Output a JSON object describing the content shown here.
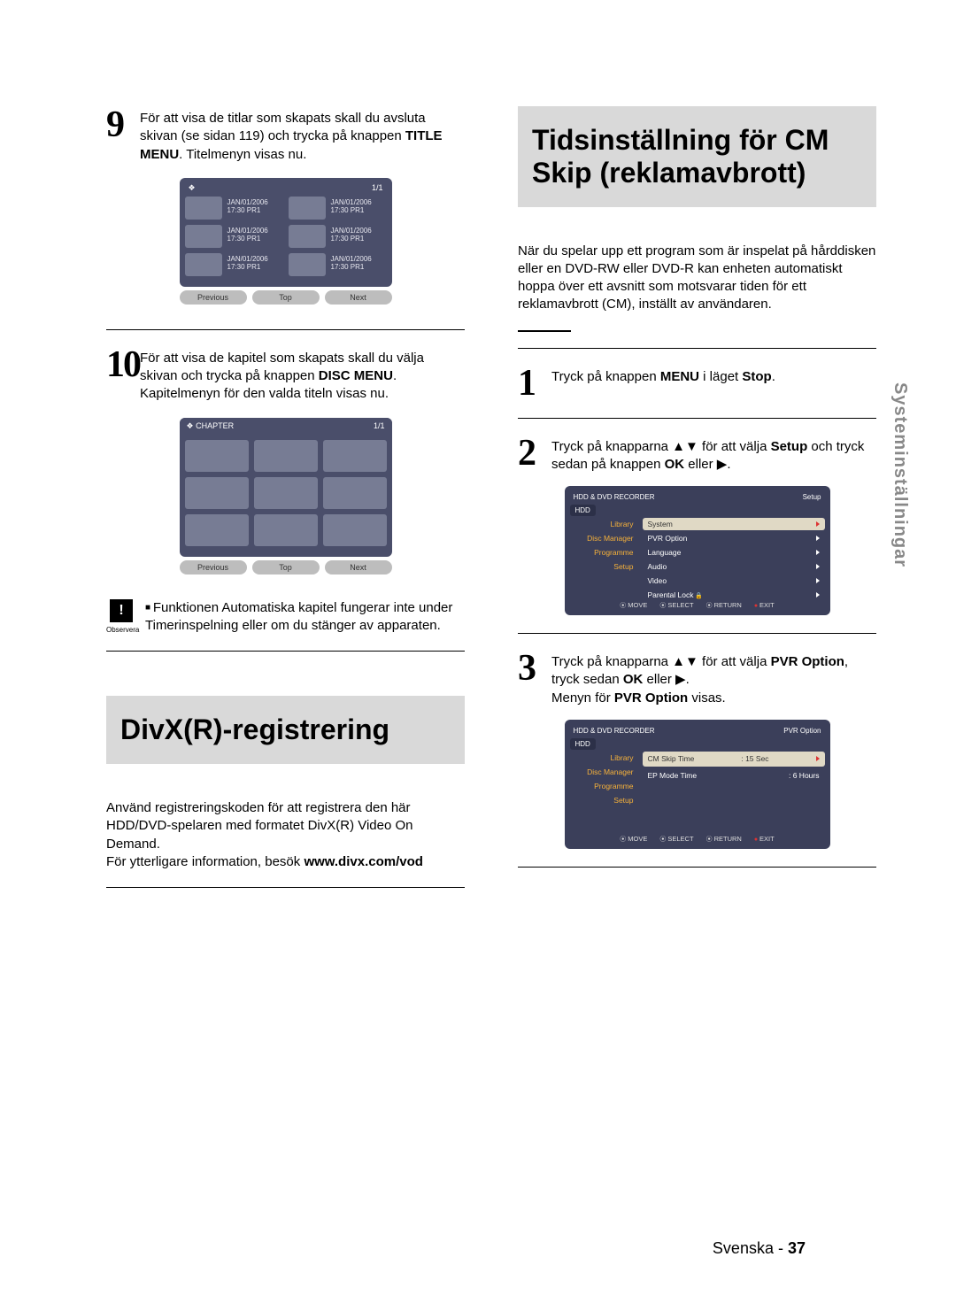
{
  "footer": {
    "lang": "Svenska",
    "sep": " - ",
    "page": "37"
  },
  "side_tab": "Systeminställningar",
  "left": {
    "step9": {
      "num": "9",
      "text_a": "För att visa de titlar som skapats skall du avsluta skivan (se sidan 119) och trycka på knappen ",
      "b1": "TITLE MENU",
      "text_b": ". Titelmenyn visas nu."
    },
    "title_menu": {
      "icon": "❖",
      "count": "1/1",
      "cells": [
        {
          "date": "JAN/01/2006",
          "time": "17:30 PR1"
        },
        {
          "date": "JAN/01/2006",
          "time": "17:30 PR1"
        },
        {
          "date": "JAN/01/2006",
          "time": "17:30 PR1"
        },
        {
          "date": "JAN/01/2006",
          "time": "17:30 PR1"
        },
        {
          "date": "JAN/01/2006",
          "time": "17:30 PR1"
        },
        {
          "date": "JAN/01/2006",
          "time": "17:30 PR1"
        }
      ],
      "btns": [
        "Previous",
        "Top",
        "Next"
      ]
    },
    "step10": {
      "num": "10",
      "text_a": "För att visa de kapitel som skapats skall du välja skivan och trycka på knappen ",
      "b1": "DISC MENU",
      "text_b": ". Kapitelmenyn för den valda titeln visas nu."
    },
    "chapter_menu": {
      "head_icon": "❖",
      "head_label": "CHAPTER",
      "count": "1/1",
      "btns": [
        "Previous",
        "Top",
        "Next"
      ]
    },
    "observe": {
      "label": "Observera",
      "text": "Funktionen Automatiska kapitel fungerar inte under Timerinspelning eller om du stänger av apparaten."
    },
    "divx_title": "DivX(R)-registrering",
    "divx_text_a": "Använd registreringskoden för att registrera den här HDD/DVD-spelaren med formatet DivX(R) Video On Demand.",
    "divx_text_b_prefix": "För ytterligare information, besök ",
    "divx_text_b_bold": "www.divx.com/vod"
  },
  "right": {
    "title": "Tidsinställning för CM Skip (reklamavbrott)",
    "intro": "När du spelar upp ett program som är inspelat på hårddisken eller en DVD-RW eller DVD-R kan enheten automatiskt hoppa över ett avsnitt som motsvarar tiden för ett reklamavbrott (CM), inställt av användaren.",
    "step1": {
      "num": "1",
      "a": "Tryck på knappen ",
      "b1": "MENU",
      "mid": " i läget ",
      "b2": "Stop",
      "end": "."
    },
    "step2": {
      "num": "2",
      "a": "Tryck på knapparna ▲▼ för att välja ",
      "b1": "Setup",
      "mid": " och tryck sedan på knappen ",
      "b2": "OK",
      "mid2": " eller ▶."
    },
    "osd1": {
      "top_left": "HDD & DVD RECORDER",
      "top_right": "Setup",
      "hdd": "HDD",
      "side": [
        "Library",
        "Disc Manager",
        "Programme",
        "Setup"
      ],
      "main": [
        {
          "label": "System",
          "sel": true
        },
        {
          "label": "PVR Option"
        },
        {
          "label": "Language"
        },
        {
          "label": "Audio"
        },
        {
          "label": "Video"
        },
        {
          "label": "Parental Lock",
          "lock": true
        }
      ],
      "hints": [
        "MOVE",
        "SELECT",
        "RETURN",
        "EXIT"
      ]
    },
    "step3": {
      "num": "3",
      "a": "Tryck på knapparna ▲▼ för att välja ",
      "b1": "PVR Option",
      "mid": ", tryck sedan ",
      "b2": "OK",
      "mid2": " eller ▶.",
      "line2_a": "Menyn för ",
      "line2_b": "PVR Option",
      "line2_c": " visas."
    },
    "osd2": {
      "top_left": "HDD & DVD RECORDER",
      "top_right": "PVR Option",
      "hdd": "HDD",
      "side": [
        "Library",
        "Disc Manager",
        "Programme",
        "Setup"
      ],
      "main": [
        {
          "label": "CM Skip Time",
          "value": ": 15 Sec",
          "sel": true
        },
        {
          "label": "EP Mode Time",
          "value": ": 6 Hours"
        }
      ],
      "hints": [
        "MOVE",
        "SELECT",
        "RETURN",
        "EXIT"
      ]
    }
  }
}
